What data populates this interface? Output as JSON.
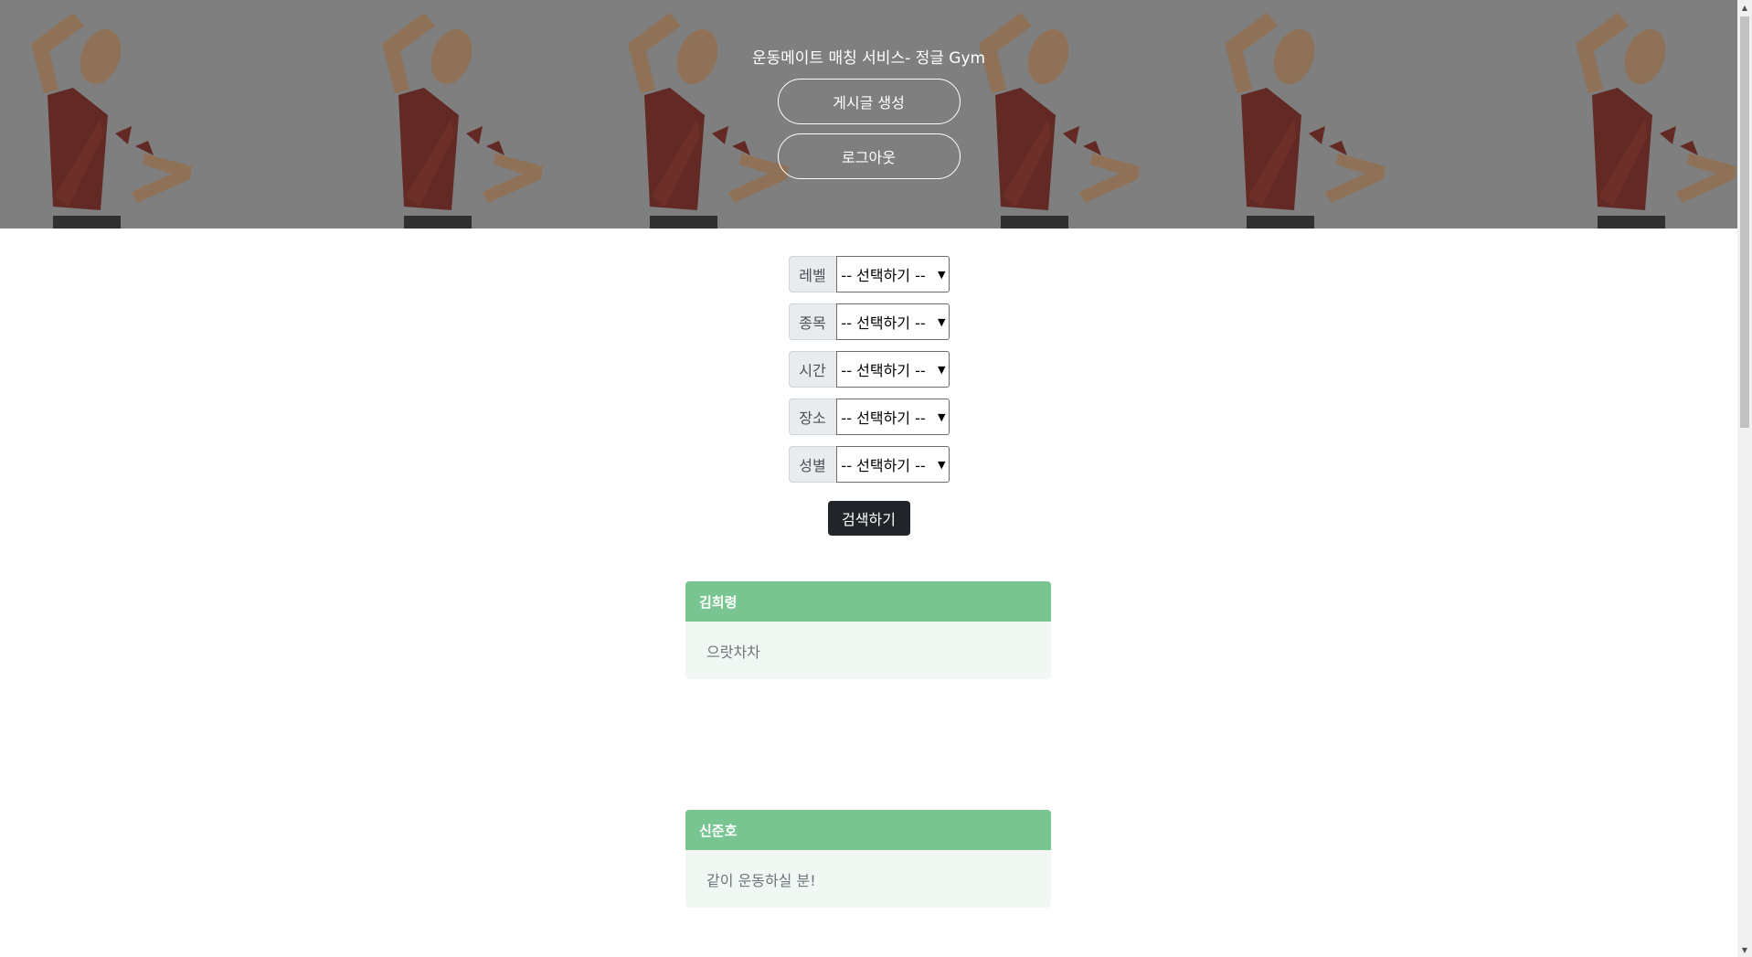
{
  "header": {
    "title": "운동메이트 매칭 서비스- 정글 Gym",
    "create_post_label": "게시글 생성",
    "logout_label": "로그아웃"
  },
  "filters": [
    {
      "label": "레벨",
      "selected": "-- 선택하기 --"
    },
    {
      "label": "종목",
      "selected": "-- 선택하기 --"
    },
    {
      "label": "시간",
      "selected": "-- 선택하기 --"
    },
    {
      "label": "장소",
      "selected": "-- 선택하기 --"
    },
    {
      "label": "성별",
      "selected": "-- 선택하기 --"
    }
  ],
  "search_label": "검색하기",
  "posts": [
    {
      "author": "김희령",
      "content": "으랏차차"
    },
    {
      "author": "신준호",
      "content": "같이 운동하실 분!"
    }
  ],
  "colors": {
    "banner": "#7f7f7f",
    "card_header": "#78c592",
    "card_body": "#f1f8f3",
    "search_button": "#212529"
  }
}
